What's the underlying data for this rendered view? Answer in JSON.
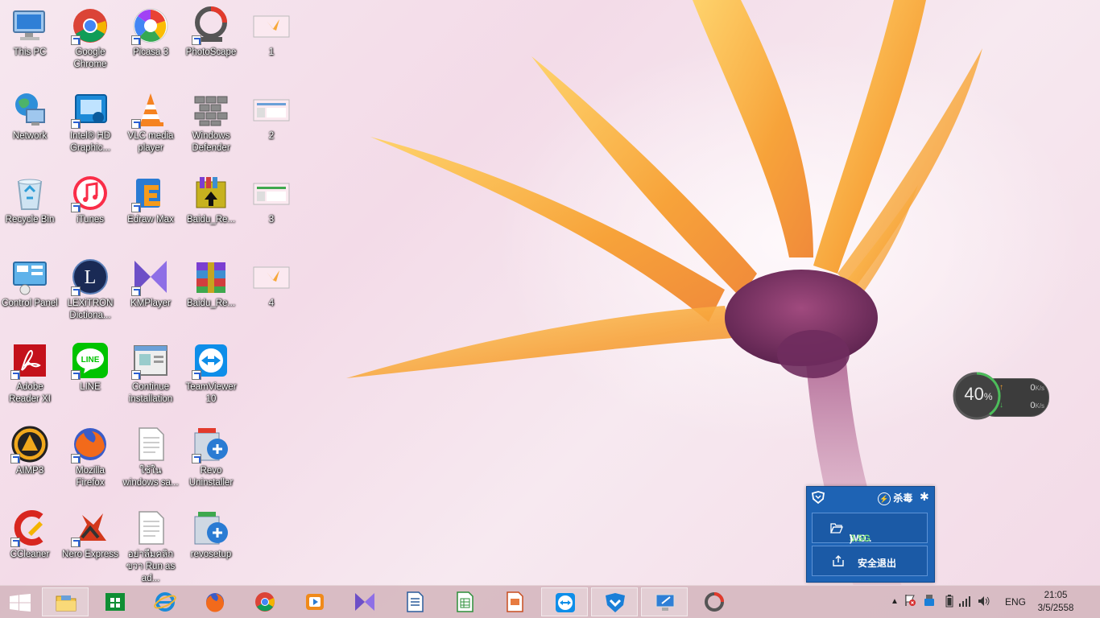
{
  "desktop": {
    "icons": [
      {
        "label": "This PC",
        "icon": "computer-icon"
      },
      {
        "label": "Google Chrome",
        "icon": "chrome-icon"
      },
      {
        "label": "Picasa 3",
        "icon": "picasa-icon"
      },
      {
        "label": "PhotoScape",
        "icon": "photoscape-icon"
      },
      {
        "label": "1",
        "icon": "image-thumbnail-icon"
      },
      {
        "label": "Network",
        "icon": "network-globe-icon"
      },
      {
        "label": "Intel® HD Graphic...",
        "icon": "intel-graphics-icon"
      },
      {
        "label": "VLC media player",
        "icon": "vlc-cone-icon"
      },
      {
        "label": "Windows Defender",
        "icon": "defender-wall-icon"
      },
      {
        "label": "2",
        "icon": "screenshot-thumbnail-icon"
      },
      {
        "label": "Recycle Bin",
        "icon": "recycle-bin-icon"
      },
      {
        "label": "iTunes",
        "icon": "itunes-icon"
      },
      {
        "label": "Edraw Max",
        "icon": "edraw-icon"
      },
      {
        "label": "Baidu_Re...",
        "icon": "installer-box-icon"
      },
      {
        "label": "3",
        "icon": "screenshot-thumbnail-icon"
      },
      {
        "label": "Control Panel",
        "icon": "control-panel-icon"
      },
      {
        "label": "LEXiTRON Dictiona...",
        "icon": "lexitron-icon"
      },
      {
        "label": "KMPlayer",
        "icon": "kmplayer-icon"
      },
      {
        "label": "Baidu_Re...",
        "icon": "winrar-icon"
      },
      {
        "label": "4",
        "icon": "image-thumbnail-icon"
      },
      {
        "label": "Adobe Reader XI",
        "icon": "adobe-reader-icon"
      },
      {
        "label": "LINE",
        "icon": "line-icon"
      },
      {
        "label": "Continue installation",
        "icon": "installation-window-icon"
      },
      {
        "label": "TeamViewer 10",
        "icon": "teamviewer-icon"
      },
      {
        "label": "AIMP3",
        "icon": "aimp-icon"
      },
      {
        "label": "Mozilla Firefox",
        "icon": "firefox-icon"
      },
      {
        "label": "ใช้ใน windows sa...",
        "icon": "text-document-icon"
      },
      {
        "label": "Revo Uninstaller",
        "icon": "revo-uninstaller-icon"
      },
      {
        "label": "CCleaner",
        "icon": "ccleaner-icon"
      },
      {
        "label": "Nero Express",
        "icon": "nero-icon"
      },
      {
        "label": "อย่าลืมคลิกขวา Run as ad...",
        "icon": "text-document-icon"
      },
      {
        "label": "revosetup",
        "icon": "revo-setup-icon"
      }
    ]
  },
  "speed_widget": {
    "percent_value": "40",
    "percent_unit": "%",
    "upload_value": "0",
    "download_value": "0",
    "unit": "K/s"
  },
  "antivirus_popup": {
    "scan_label": "杀毒",
    "drive_prefix": "WO.. (G:",
    "drive_size": "3.5G",
    "drive_suffix": ")",
    "safe_eject_label": "安全退出"
  },
  "taskbar": {
    "apps": [
      {
        "name": "file-explorer"
      },
      {
        "name": "store"
      },
      {
        "name": "internet-explorer"
      },
      {
        "name": "firefox"
      },
      {
        "name": "chrome"
      },
      {
        "name": "media-player"
      },
      {
        "name": "kmplayer"
      },
      {
        "name": "writer"
      },
      {
        "name": "calc"
      },
      {
        "name": "impress"
      },
      {
        "name": "teamviewer"
      },
      {
        "name": "antivirus"
      },
      {
        "name": "remote-desktop"
      },
      {
        "name": "photoscape"
      }
    ],
    "tray": {
      "language": "ENG",
      "time": "21:05",
      "date": "3/5/2558"
    }
  },
  "colors": {
    "taskbar": "#d6b9c0",
    "av_blue": "#1e63b4",
    "flower_orange": "#f7a83a",
    "flower_purple": "#7a2d66"
  }
}
